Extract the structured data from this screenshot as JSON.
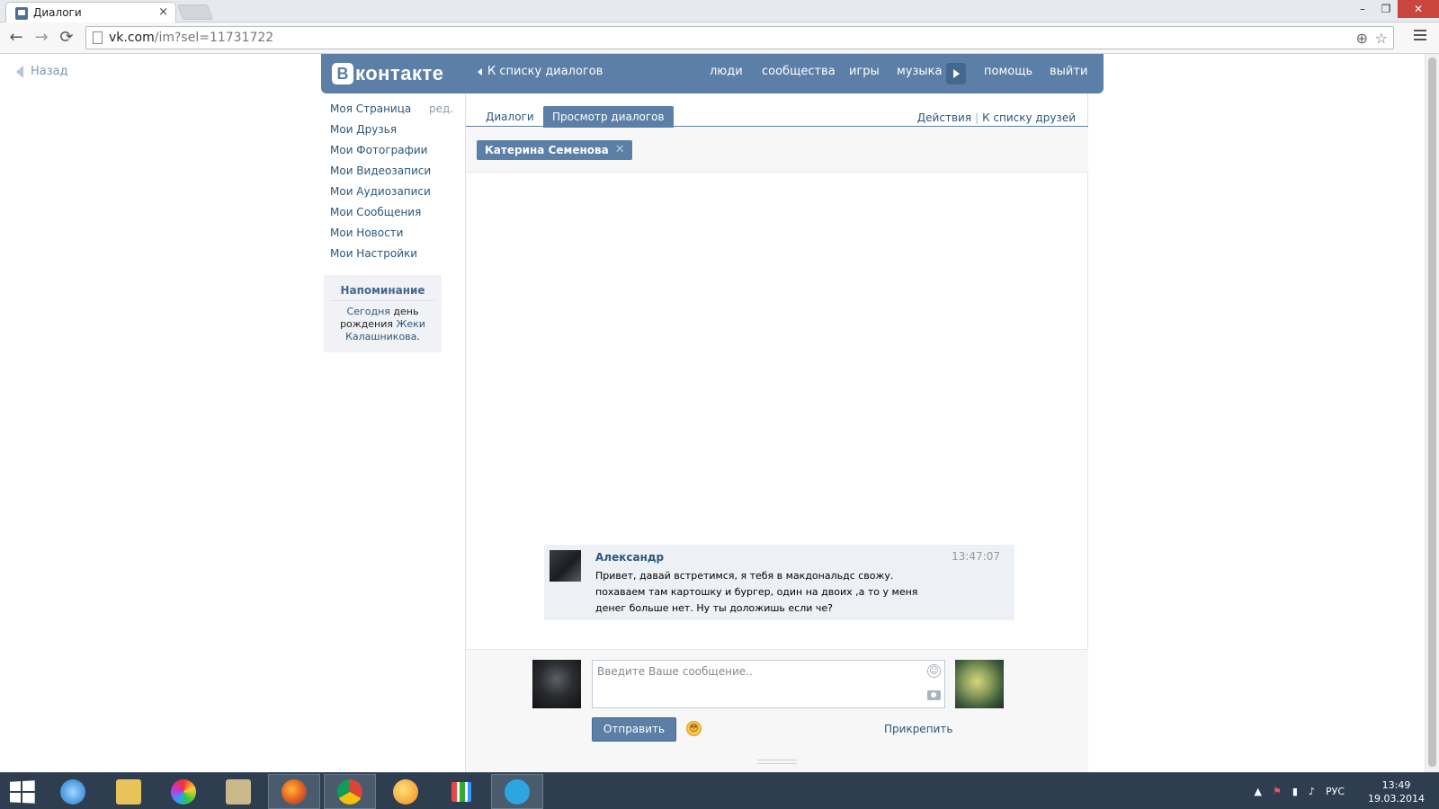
{
  "browser": {
    "tab_title": "Диалоги",
    "tab_close": "×",
    "url_host": "vk.com",
    "url_path": "/im?sel=11731722",
    "back_glyph": "←",
    "forward_glyph": "→",
    "reload_glyph": "⟳",
    "zoom_glyph": "⊕",
    "star_glyph": "☆",
    "minimize_glyph": "–",
    "restore_glyph": "❐",
    "close_glyph": "✕"
  },
  "page": {
    "back_link": "Назад"
  },
  "vk_header": {
    "logo_letter": "В",
    "logo_text": "контакте",
    "back_to_dialogs": "К списку диалогов",
    "nav": [
      "люди",
      "сообщества",
      "игры",
      "музыка",
      "помощь",
      "выйти"
    ]
  },
  "sidebar": {
    "items": [
      "Моя Страница",
      "Мои Друзья",
      "Мои Фотографии",
      "Мои Видеозаписи",
      "Мои Аудиозаписи",
      "Мои Сообщения",
      "Мои Новости",
      "Мои Настройки"
    ],
    "edit": "ред.",
    "reminder": {
      "title": "Напоминание",
      "today": "Сегодня",
      "birthday": "день рождения",
      "person_1": "Жеки",
      "person_2": "Калашникова",
      "period": "."
    }
  },
  "dialogs": {
    "tab_dialogs": "Диалоги",
    "tab_view": "Просмотр диалогов",
    "actions": "Действия",
    "separator": "|",
    "to_friends": "К списку друзей",
    "recipient": "Катерина Семенова",
    "recipient_remove": "✕"
  },
  "message": {
    "author": "Александр",
    "time": "13:47:07",
    "text": "Привет, давай встретимся, я тебя в макдональдс свожу. похаваем там картошку и бургер, один на двоих ,а то у меня денег больше нет. Ну ты доложишь если че?"
  },
  "compose": {
    "placeholder": "Введите Ваше сообщение..",
    "send": "Отправить",
    "attach": "Прикрепить",
    "smile_glyph": "☺",
    "emoji_glyph": "😳"
  },
  "taskbar": {
    "apps": [
      "internet-explorer",
      "file-explorer",
      "picasa",
      "notepad-like",
      "firefox",
      "chrome",
      "media-player",
      "apps-grid",
      "telegram"
    ],
    "tray_lang": "РУС",
    "time": "13:49",
    "date": "19.03.2014"
  },
  "colors": {
    "vk_blue": "#5b7fa6",
    "vk_link": "#2b587a",
    "taskbar": "#2e3e50"
  }
}
